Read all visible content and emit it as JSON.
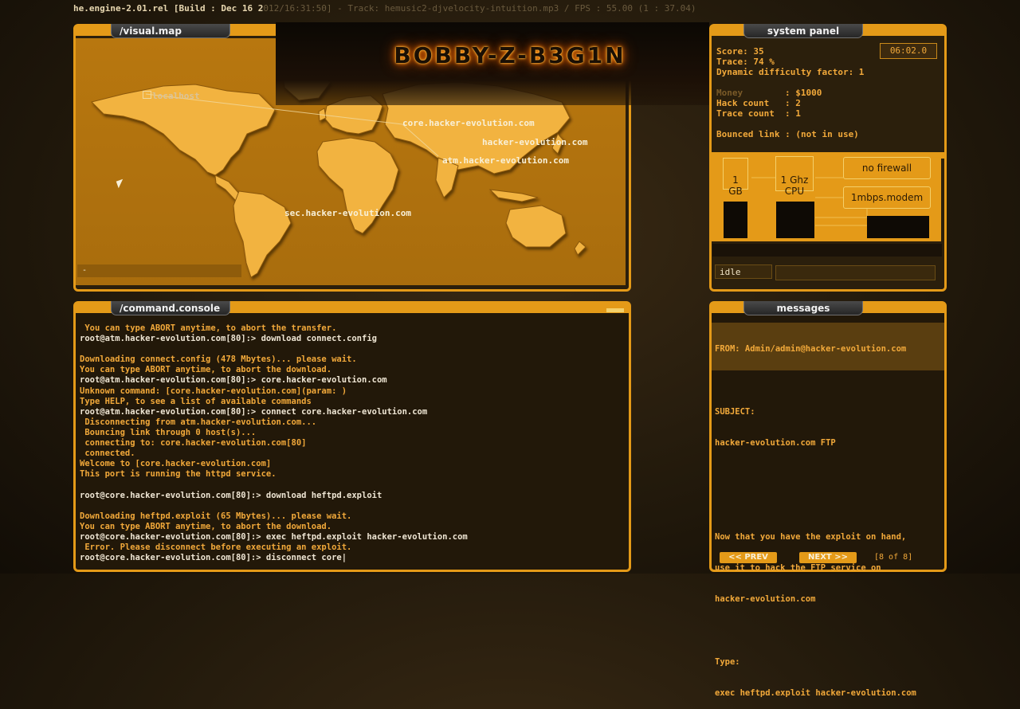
{
  "topbar": {
    "engine": "he.engine-2.01.rel [Build : Dec 16 2",
    "rest": "012/16:31:50] - Track: hemusic2-djvelocity-intuition.mp3 / FPS : 55.00 (1 : 37.04)"
  },
  "logo": {
    "text": "BOBBY-Z-B3G1N"
  },
  "map": {
    "title": "/visual.map",
    "hosts": [
      {
        "label": "localhost"
      },
      {
        "label": "core.hacker-evolution.com"
      },
      {
        "label": "hacker-evolution.com"
      },
      {
        "label": "atm.hacker-evolution.com"
      },
      {
        "label": "sec.hacker-evolution.com"
      }
    ],
    "status": "-"
  },
  "system": {
    "title": "system panel",
    "clock": "06:02.0",
    "score": "Score: 35",
    "trace": "Trace: 74 %",
    "difficulty": "Dynamic difficulty factor: 1",
    "money_label": "Money",
    "money_value": ": $1000",
    "hack_label": "Hack count",
    "hack_value": ":  2",
    "tracecount_label": "Trace count",
    "tracecount_value": ":  1",
    "bounced": "Bounced link : (not in use)",
    "memory": "1\nGB",
    "cpu": "1 Ghz\nCPU",
    "firewall": "no firewall",
    "modem": "1mbps.modem",
    "status": "idle"
  },
  "console": {
    "title": "/command.console",
    "lines": [
      {
        "text": " You can type ABORT anytime, to abort the transfer.",
        "color": "orange"
      },
      {
        "text": "root@atm.hacker-evolution.com[80]:> download connect.config",
        "color": "white"
      },
      {
        "text": "",
        "color": "white"
      },
      {
        "text": "Downloading connect.config (478 Mbytes)... please wait.",
        "color": "orange"
      },
      {
        "text": "You can type ABORT anytime, to abort the download.",
        "color": "orange"
      },
      {
        "text": "root@atm.hacker-evolution.com[80]:> core.hacker-evolution.com",
        "color": "white"
      },
      {
        "text": "Unknown command: [core.hacker-evolution.com](param: )",
        "color": "orange"
      },
      {
        "text": "Type HELP, to see a list of available commands",
        "color": "orange"
      },
      {
        "text": "root@atm.hacker-evolution.com[80]:> connect core.hacker-evolution.com",
        "color": "white"
      },
      {
        "text": " Disconnecting from atm.hacker-evolution.com...",
        "color": "orange"
      },
      {
        "text": " Bouncing link through 0 host(s)...",
        "color": "orange"
      },
      {
        "text": " connecting to: core.hacker-evolution.com[80]",
        "color": "orange"
      },
      {
        "text": " connected.",
        "color": "orange"
      },
      {
        "text": "Welcome to [core.hacker-evolution.com]",
        "color": "orange"
      },
      {
        "text": "This port is running the httpd service.",
        "color": "orange"
      },
      {
        "text": "",
        "color": "white"
      },
      {
        "text": "root@core.hacker-evolution.com[80]:> download heftpd.exploit",
        "color": "white"
      },
      {
        "text": "",
        "color": "white"
      },
      {
        "text": "Downloading heftpd.exploit (65 Mbytes)... please wait.",
        "color": "orange"
      },
      {
        "text": "You can type ABORT anytime, to abort the download.",
        "color": "orange"
      },
      {
        "text": "root@core.hacker-evolution.com[80]:> exec heftpd.exploit hacker-evolution.com",
        "color": "white"
      },
      {
        "text": " Error. Please disconnect before executing an exploit.",
        "color": "orange"
      },
      {
        "text": "root@core.hacker-evolution.com[80]:> disconnect core|",
        "color": "white"
      }
    ]
  },
  "messages": {
    "title": "messages",
    "from": "FROM: Admin/admin@hacker-evolution.com",
    "subject_label": "SUBJECT:",
    "subject": "hacker-evolution.com FTP",
    "body": [
      "Now that you have the exploit on hand,",
      "use it to hack the FTP service on",
      "hacker-evolution.com",
      "",
      "Type:",
      "exec heftpd.exploit hacker-evolution.com"
    ],
    "prev": "<< PREV",
    "next": "NEXT >>",
    "page": "[8 of 8]"
  }
}
